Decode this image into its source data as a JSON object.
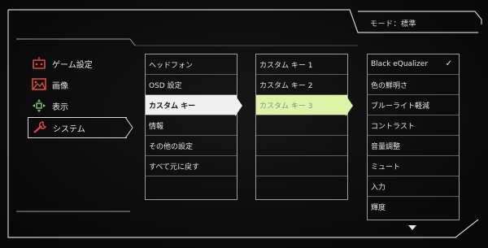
{
  "header": {
    "mode_text": "モード：標準"
  },
  "menu": {
    "items": [
      {
        "label": "ゲーム設定",
        "icon": "gamepad-icon"
      },
      {
        "label": "画像",
        "icon": "image-icon"
      },
      {
        "label": "表示",
        "icon": "display-arrows-icon"
      },
      {
        "label": "システム",
        "icon": "wrench-icon"
      }
    ],
    "active_index": 3
  },
  "system_list": {
    "items": [
      "ヘッドフォン",
      "OSD 設定",
      "カスタム キー",
      "情報",
      "その他の設定",
      "すべて元に戻す",
      "",
      ""
    ],
    "selected_index": 2
  },
  "custom_key_list": {
    "items": [
      "カスタム キー 1",
      "カスタム キー 2",
      "カスタム キー 3",
      "",
      "",
      "",
      ""
    ],
    "highlighted_index": 2
  },
  "options_list": {
    "items": [
      "Black eQualizer",
      "色の鮮明さ",
      "ブルーライト軽減",
      "コントラスト",
      "音量調整",
      "ミュート",
      "入力",
      "輝度"
    ],
    "checked_index": 0,
    "check_symbol": "✓"
  },
  "colors": {
    "accent_red": "#d84a3a",
    "accent_green": "#7fd36a",
    "highlight_lime": "#dff3a8",
    "selected_white": "#f0f0f0"
  }
}
